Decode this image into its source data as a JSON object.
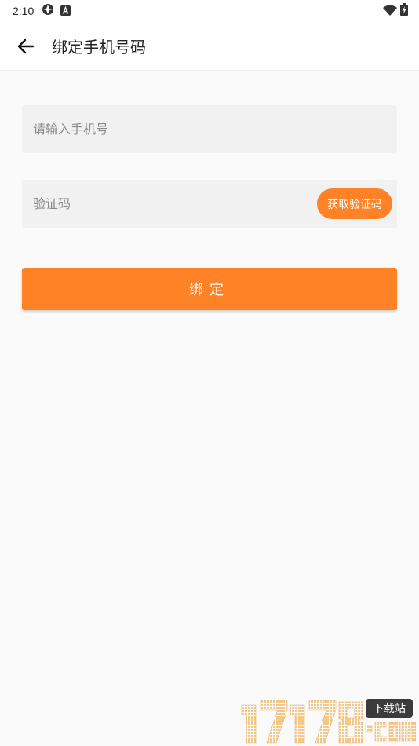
{
  "status_bar": {
    "time": "2:10"
  },
  "header": {
    "title": "绑定手机号码"
  },
  "form": {
    "phone_placeholder": "请输入手机号",
    "code_placeholder": "验证码",
    "get_code_label": "获取验证码",
    "bind_label": "绑定"
  },
  "colors": {
    "accent": "#ff8226",
    "field_bg": "#f1f1f1",
    "page_bg": "#fafafa"
  },
  "watermark": {
    "text": "17178",
    "domain": ".COM",
    "tag": "下载站"
  }
}
